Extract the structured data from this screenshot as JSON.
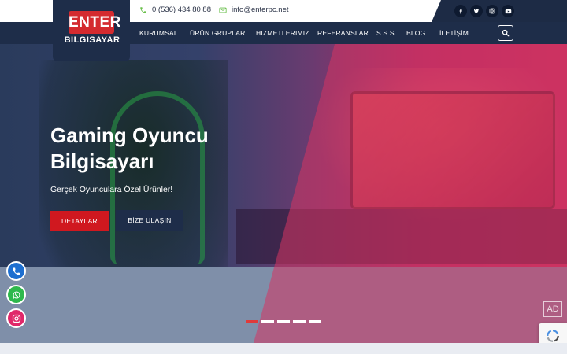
{
  "topbar": {
    "phone": "0 (536) 434 80 88",
    "email": "info@enterpc.net",
    "social_icons": [
      "facebook-icon",
      "twitter-icon",
      "instagram-icon",
      "youtube-icon"
    ]
  },
  "logo": {
    "line1": "ENTER",
    "line2": "BILGISAYAR"
  },
  "nav": {
    "items": [
      {
        "label": "KURUMSAL"
      },
      {
        "label": "ÜRÜN GRUPLARI"
      },
      {
        "label": "HIZMETLERIMIZ"
      },
      {
        "label": "REFERANSLAR"
      },
      {
        "label": "S.S.S"
      },
      {
        "label": "BLOG"
      },
      {
        "label": "İLETİŞİM"
      }
    ],
    "search_icon": "search-icon"
  },
  "hero": {
    "title": "Gaming Oyuncu Bilgisayarı",
    "subtitle": "Gerçek Oyunculara Özel Ürünler!",
    "primary_button": "DETAYLAR",
    "secondary_button": "BİZE ULAŞIN",
    "slides_total": 5,
    "active_slide": 1
  },
  "floating_buttons": [
    "phone-icon",
    "whatsapp-icon",
    "instagram-icon"
  ],
  "ad_label": "AD",
  "colors": {
    "navy": "#1e2d49",
    "brand_red": "#d42a2f",
    "button_red": "#d0181f",
    "phone_blue": "#1e6fd0",
    "whatsapp_green": "#2eb84c",
    "instagram_pink": "#e0286a"
  }
}
